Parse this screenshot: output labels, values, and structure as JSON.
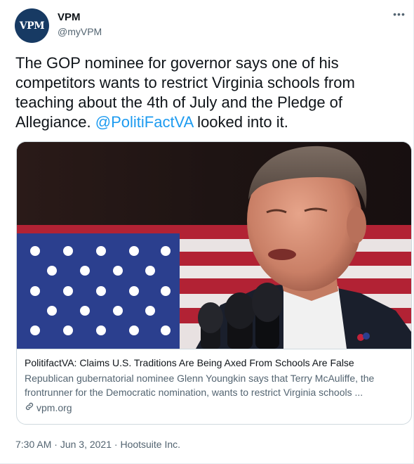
{
  "author": {
    "avatar_text": "VPM",
    "name": "VPM",
    "handle": "@myVPM"
  },
  "more_menu": {
    "icon": "more-horizontal-icon",
    "glyph": "•••"
  },
  "tweet": {
    "text_before_mention": "The GOP nominee for governor says one of his competitors wants to restrict Virginia schools from teaching about the 4th of July and the Pledge of Allegiance. ",
    "mention": "@PolitiFactVA",
    "text_after_mention": " looked into it."
  },
  "card": {
    "title": "PolitifactVA: Claims U.S. Traditions Are Being Axed From Schools Are False",
    "description": "Republican gubernatorial nominee Glenn Youngkin says that Terry McAuliffe, the frontrunner for the Democratic nomination, wants to restrict Virginia schools ...",
    "domain": "vpm.org",
    "domain_icon": "link-icon"
  },
  "meta": {
    "time": "7:30 AM",
    "separator": " · ",
    "date": "Jun 3, 2021",
    "source": "Hootsuite Inc."
  },
  "colors": {
    "link": "#1d9bf0",
    "secondary_text": "#536471",
    "primary_text": "#0f1419",
    "avatar_bg": "#173a63",
    "border": "#cfd9de"
  }
}
